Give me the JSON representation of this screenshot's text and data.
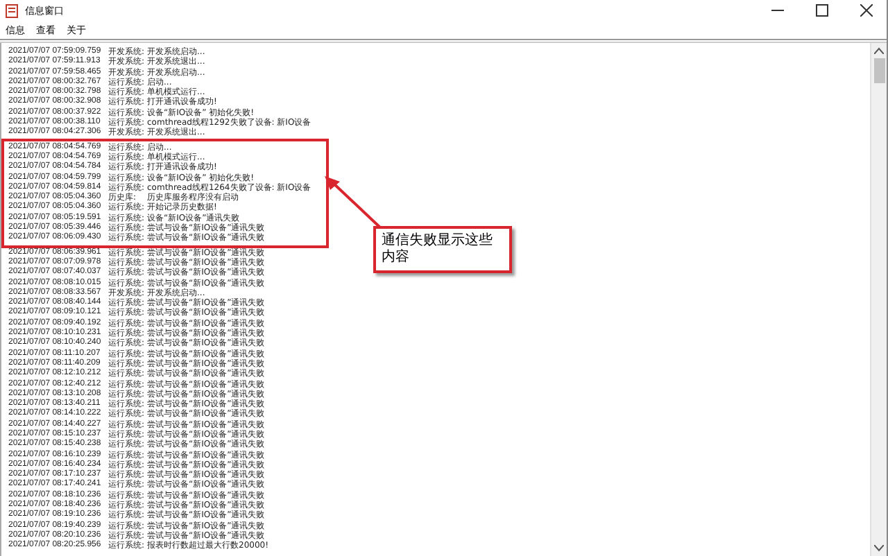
{
  "window": {
    "title": "信息窗口"
  },
  "menu": [
    "信息",
    "查看",
    "关于"
  ],
  "log": [
    {
      "time": "2021/07/07 07:59:09.759",
      "source": "开发系统:",
      "message": "开发系统启动...",
      "in_callout": false
    },
    {
      "time": "2021/07/07 07:59:11.913",
      "source": "开发系统:",
      "message": "开发系统退出...",
      "in_callout": false
    },
    {
      "time": "2021/07/07 07:59:58.465",
      "source": "开发系统:",
      "message": "开发系统启动...",
      "in_callout": false
    },
    {
      "time": "2021/07/07 08:00:32.767",
      "source": "运行系统:",
      "message": "启动...",
      "in_callout": false
    },
    {
      "time": "2021/07/07 08:00:32.798",
      "source": "运行系统:",
      "message": "单机模式运行...",
      "in_callout": false
    },
    {
      "time": "2021/07/07 08:00:32.908",
      "source": "运行系统:",
      "message": "打开通讯设备成功!",
      "in_callout": false
    },
    {
      "time": "2021/07/07 08:00:37.922",
      "source": "运行系统:",
      "message": "设备“新IO设备” 初始化失败!",
      "in_callout": false
    },
    {
      "time": "2021/07/07 08:00:38.110",
      "source": "运行系统:",
      "message": "comthread线程1292失败了设备: 新IO设备",
      "in_callout": false
    },
    {
      "time": "2021/07/07 08:04:27.306",
      "source": "开发系统:",
      "message": "开发系统退出...",
      "in_callout": false
    },
    {
      "time": "2021/07/07 08:04:54.769",
      "source": "运行系统:",
      "message": "启动...",
      "in_callout": true
    },
    {
      "time": "2021/07/07 08:04:54.769",
      "source": "运行系统:",
      "message": "单机模式运行...",
      "in_callout": true
    },
    {
      "time": "2021/07/07 08:04:54.784",
      "source": "运行系统:",
      "message": "打开通讯设备成功!",
      "in_callout": true
    },
    {
      "time": "2021/07/07 08:04:59.799",
      "source": "运行系统:",
      "message": "设备“新IO设备” 初始化失败!",
      "in_callout": true
    },
    {
      "time": "2021/07/07 08:04:59.814",
      "source": "运行系统:",
      "message": "comthread线程1264失败了设备: 新IO设备",
      "in_callout": true
    },
    {
      "time": "2021/07/07 08:05:04.360",
      "source": "历史库:",
      "message": "历史库服务程序没有启动",
      "in_callout": true
    },
    {
      "time": "2021/07/07 08:05:04.360",
      "source": "运行系统:",
      "message": "开始记录历史数据!",
      "in_callout": true
    },
    {
      "time": "2021/07/07 08:05:19.591",
      "source": "运行系统:",
      "message": "设备“新IO设备”通讯失败",
      "in_callout": true
    },
    {
      "time": "2021/07/07 08:05:39.446",
      "source": "运行系统:",
      "message": "尝试与设备“新IO设备”通讯失败",
      "in_callout": true
    },
    {
      "time": "2021/07/07 08:06:09.430",
      "source": "运行系统:",
      "message": "尝试与设备“新IO设备”通讯失败",
      "in_callout": true
    },
    {
      "time": "2021/07/07 08:06:39.961",
      "source": "运行系统:",
      "message": "尝试与设备“新IO设备”通讯失败",
      "in_callout": false
    },
    {
      "time": "2021/07/07 08:07:09.978",
      "source": "运行系统:",
      "message": "尝试与设备“新IO设备”通讯失败",
      "in_callout": false
    },
    {
      "time": "2021/07/07 08:07:40.037",
      "source": "运行系统:",
      "message": "尝试与设备“新IO设备”通讯失败",
      "in_callout": false
    },
    {
      "time": "2021/07/07 08:08:10.015",
      "source": "运行系统:",
      "message": "尝试与设备“新IO设备”通讯失败",
      "in_callout": false
    },
    {
      "time": "2021/07/07 08:08:33.567",
      "source": "开发系统:",
      "message": "开发系统启动...",
      "in_callout": false
    },
    {
      "time": "2021/07/07 08:08:40.144",
      "source": "运行系统:",
      "message": "尝试与设备“新IO设备”通讯失败",
      "in_callout": false
    },
    {
      "time": "2021/07/07 08:09:10.121",
      "source": "运行系统:",
      "message": "尝试与设备“新IO设备”通讯失败",
      "in_callout": false
    },
    {
      "time": "2021/07/07 08:09:40.192",
      "source": "运行系统:",
      "message": "尝试与设备“新IO设备”通讯失败",
      "in_callout": false
    },
    {
      "time": "2021/07/07 08:10:10.231",
      "source": "运行系统:",
      "message": "尝试与设备“新IO设备”通讯失败",
      "in_callout": false
    },
    {
      "time": "2021/07/07 08:10:40.240",
      "source": "运行系统:",
      "message": "尝试与设备“新IO设备”通讯失败",
      "in_callout": false
    },
    {
      "time": "2021/07/07 08:11:10.207",
      "source": "运行系统:",
      "message": "尝试与设备“新IO设备”通讯失败",
      "in_callout": false
    },
    {
      "time": "2021/07/07 08:11:40.209",
      "source": "运行系统:",
      "message": "尝试与设备“新IO设备”通讯失败",
      "in_callout": false
    },
    {
      "time": "2021/07/07 08:12:10.212",
      "source": "运行系统:",
      "message": "尝试与设备“新IO设备”通讯失败",
      "in_callout": false
    },
    {
      "time": "2021/07/07 08:12:40.212",
      "source": "运行系统:",
      "message": "尝试与设备“新IO设备”通讯失败",
      "in_callout": false
    },
    {
      "time": "2021/07/07 08:13:10.208",
      "source": "运行系统:",
      "message": "尝试与设备“新IO设备”通讯失败",
      "in_callout": false
    },
    {
      "time": "2021/07/07 08:13:40.211",
      "source": "运行系统:",
      "message": "尝试与设备“新IO设备”通讯失败",
      "in_callout": false
    },
    {
      "time": "2021/07/07 08:14:10.222",
      "source": "运行系统:",
      "message": "尝试与设备“新IO设备”通讯失败",
      "in_callout": false
    },
    {
      "time": "2021/07/07 08:14:40.227",
      "source": "运行系统:",
      "message": "尝试与设备“新IO设备”通讯失败",
      "in_callout": false
    },
    {
      "time": "2021/07/07 08:15:10.237",
      "source": "运行系统:",
      "message": "尝试与设备“新IO设备”通讯失败",
      "in_callout": false
    },
    {
      "time": "2021/07/07 08:15:40.238",
      "source": "运行系统:",
      "message": "尝试与设备“新IO设备”通讯失败",
      "in_callout": false
    },
    {
      "time": "2021/07/07 08:16:10.239",
      "source": "运行系统:",
      "message": "尝试与设备“新IO设备”通讯失败",
      "in_callout": false
    },
    {
      "time": "2021/07/07 08:16:40.234",
      "source": "运行系统:",
      "message": "尝试与设备“新IO设备”通讯失败",
      "in_callout": false
    },
    {
      "time": "2021/07/07 08:17:10.237",
      "source": "运行系统:",
      "message": "尝试与设备“新IO设备”通讯失败",
      "in_callout": false
    },
    {
      "time": "2021/07/07 08:17:40.241",
      "source": "运行系统:",
      "message": "尝试与设备“新IO设备”通讯失败",
      "in_callout": false
    },
    {
      "time": "2021/07/07 08:18:10.236",
      "source": "运行系统:",
      "message": "尝试与设备“新IO设备”通讯失败",
      "in_callout": false
    },
    {
      "time": "2021/07/07 08:18:40.236",
      "source": "运行系统:",
      "message": "尝试与设备“新IO设备”通讯失败",
      "in_callout": false
    },
    {
      "time": "2021/07/07 08:19:10.236",
      "source": "运行系统:",
      "message": "尝试与设备“新IO设备”通讯失败",
      "in_callout": false
    },
    {
      "time": "2021/07/07 08:19:40.239",
      "source": "运行系统:",
      "message": "尝试与设备“新IO设备”通讯失败",
      "in_callout": false
    },
    {
      "time": "2021/07/07 08:20:10.236",
      "source": "运行系统:",
      "message": "尝试与设备“新IO设备”通讯失败",
      "in_callout": false
    },
    {
      "time": "2021/07/07 08:20:25.956",
      "source": "运行系统:",
      "message": "报表时行数超过最大行数20000!",
      "in_callout": false
    }
  ],
  "annotation": {
    "text": "通信失败显示这些内容"
  }
}
